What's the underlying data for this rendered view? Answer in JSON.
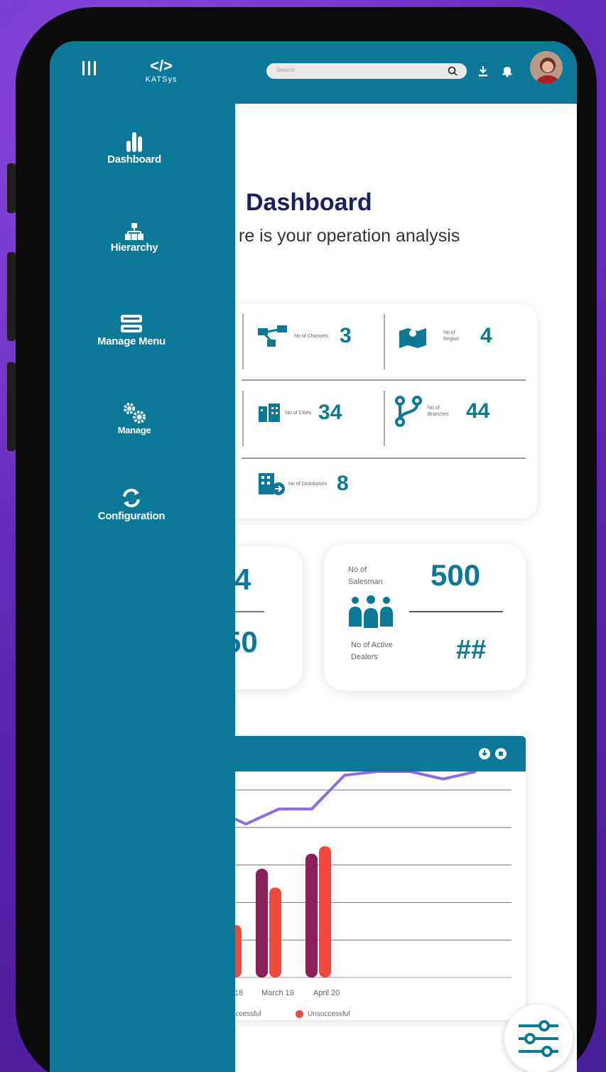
{
  "colors": {
    "primary": "#0a7896",
    "title": "#1c1e5e",
    "bar_successful": "#8a1f5a",
    "bar_unsuccessful": "#f04a3a",
    "line": "#8a6ce8"
  },
  "header": {
    "logo_text": "KATSys",
    "search_placeholder": "Search"
  },
  "sidebar": {
    "items": [
      {
        "label": "Dashboard",
        "icon": "bar-chart-icon"
      },
      {
        "label": "Hierarchy",
        "icon": "hierarchy-icon"
      },
      {
        "label": "Manage Menu",
        "icon": "server-icon"
      },
      {
        "label": "Manage",
        "icon": "gears-icon"
      },
      {
        "label": "Configuration",
        "icon": "sync-icon"
      }
    ]
  },
  "main": {
    "title": "Dashboard",
    "subtitle": "re is your operation analysis",
    "stats": {
      "channels": {
        "label": "No of Channels",
        "value": "3"
      },
      "region": {
        "label": "No of Region",
        "value": "4"
      },
      "cities": {
        "label": "No of Cities",
        "value": "34"
      },
      "branches": {
        "label": "No of Branches",
        "value": "44"
      },
      "distributors": {
        "label": "No of Distributors",
        "value": "8"
      }
    },
    "left_card": {
      "value_top": "4",
      "value_bottom": "50"
    },
    "people_card": {
      "salesman_label": "No of Salesman",
      "salesman_value": "500",
      "dealers_label": "No of Active Dealers",
      "dealers_value": "##"
    }
  },
  "chart_data": {
    "type": "bar",
    "categories": [
      "18",
      "March 19",
      "April 20"
    ],
    "series": [
      {
        "name": "Successful",
        "values": [
          null,
          2.9,
          3.3
        ]
      },
      {
        "name": "Unsuccessful",
        "values": [
          1.4,
          2.4,
          3.5
        ]
      }
    ],
    "line_series": {
      "values": [
        4.0,
        3.6,
        4.0,
        4.0,
        4.9,
        5.0,
        5.0,
        4.8,
        5.0
      ]
    },
    "legend": [
      "Successful",
      "Unsuccessful"
    ],
    "legend_partial": "uccessful",
    "ylim": [
      0,
      5
    ],
    "grid": true
  }
}
